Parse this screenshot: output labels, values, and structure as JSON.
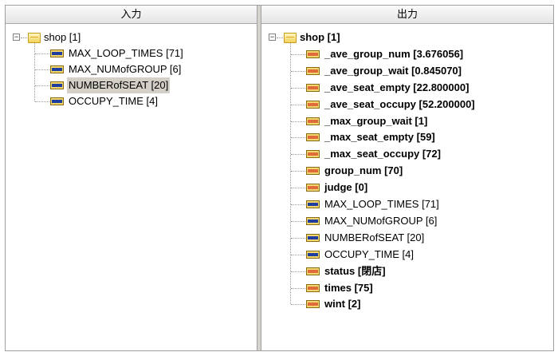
{
  "left_pane": {
    "header": "入力",
    "root": {
      "label": "shop [1]",
      "expander": "−"
    },
    "items": [
      {
        "label": "MAX_LOOP_TIMES [71]",
        "icon": "variable-icon-blue",
        "bold": false,
        "selected": false
      },
      {
        "label": "MAX_NUMofGROUP [6]",
        "icon": "variable-icon-blue",
        "bold": false,
        "selected": false
      },
      {
        "label": "NUMBERofSEAT [20]",
        "icon": "variable-icon-blue",
        "bold": false,
        "selected": true
      },
      {
        "label": "OCCUPY_TIME [4]",
        "icon": "variable-icon-blue",
        "bold": false,
        "selected": false
      }
    ]
  },
  "right_pane": {
    "header": "出力",
    "root": {
      "label": "shop [1]",
      "expander": "−"
    },
    "items": [
      {
        "label": "_ave_group_num [3.676056]",
        "icon": "variable-icon-orange",
        "bold": true
      },
      {
        "label": "_ave_group_wait [0.845070]",
        "icon": "variable-icon-orange",
        "bold": true
      },
      {
        "label": "_ave_seat_empty [22.800000]",
        "icon": "variable-icon-orange",
        "bold": true
      },
      {
        "label": "_ave_seat_occupy [52.200000]",
        "icon": "variable-icon-orange",
        "bold": true
      },
      {
        "label": "_max_group_wait [1]",
        "icon": "variable-icon-orange",
        "bold": true
      },
      {
        "label": "_max_seat_empty [59]",
        "icon": "variable-icon-orange",
        "bold": true
      },
      {
        "label": "_max_seat_occupy [72]",
        "icon": "variable-icon-orange",
        "bold": true
      },
      {
        "label": "group_num [70]",
        "icon": "variable-icon-orange",
        "bold": true
      },
      {
        "label": "judge [0]",
        "icon": "variable-icon-orange",
        "bold": true
      },
      {
        "label": "MAX_LOOP_TIMES [71]",
        "icon": "variable-icon-blue",
        "bold": false
      },
      {
        "label": "MAX_NUMofGROUP [6]",
        "icon": "variable-icon-blue",
        "bold": false
      },
      {
        "label": "NUMBERofSEAT [20]",
        "icon": "variable-icon-blue",
        "bold": false
      },
      {
        "label": "OCCUPY_TIME [4]",
        "icon": "variable-icon-blue",
        "bold": false
      },
      {
        "label": "status [閉店]",
        "icon": "variable-icon-orange",
        "bold": true
      },
      {
        "label": "times [75]",
        "icon": "variable-icon-orange",
        "bold": true
      },
      {
        "label": "wint [2]",
        "icon": "variable-icon-orange",
        "bold": true
      }
    ]
  },
  "colors": {
    "folder_fill": "#f3d35c",
    "input_var_band": "#1e3d9e",
    "output_var_band": "#e06b3a",
    "selection": "#d4d0c8"
  }
}
